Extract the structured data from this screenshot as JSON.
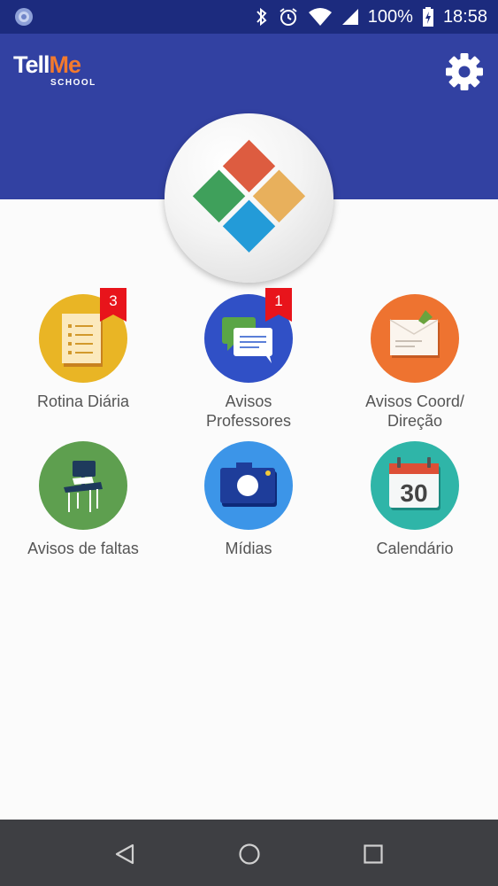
{
  "status_bar": {
    "battery": "100%",
    "time": "18:58"
  },
  "header": {
    "logo_text_1": "Tell",
    "logo_text_2": "Me",
    "logo_sub": "SCHOOL"
  },
  "menu": {
    "items": [
      {
        "label_lines": [
          "Rotina Diária"
        ],
        "badge": "3"
      },
      {
        "label_lines": [
          "Avisos",
          "Professores"
        ],
        "badge": "1"
      },
      {
        "label_lines": [
          "Avisos Coord/",
          "Direção"
        ]
      },
      {
        "label_lines": [
          "Avisos de faltas"
        ]
      },
      {
        "label_lines": [
          "Mídias"
        ]
      },
      {
        "label_lines": [
          "Calendário"
        ],
        "calendar_day": "30"
      }
    ]
  },
  "colors": {
    "status_bar": "#1c2b7e",
    "header": "#3241a2",
    "rotina": "#e9b525",
    "avisos_professores": "#3050c6",
    "avisos_coord": "#ee7330",
    "faltas": "#5e9f4f",
    "midias": "#3c95e8",
    "calendario": "#2fb5a8",
    "badge": "#e8141b",
    "nav_bar": "#3e3f43"
  },
  "icons": {
    "status_left": "app-notification-icon",
    "settings": "gear-icon",
    "nav_back": "back-triangle-icon",
    "nav_home": "home-circle-icon",
    "nav_recents": "recents-square-icon"
  }
}
